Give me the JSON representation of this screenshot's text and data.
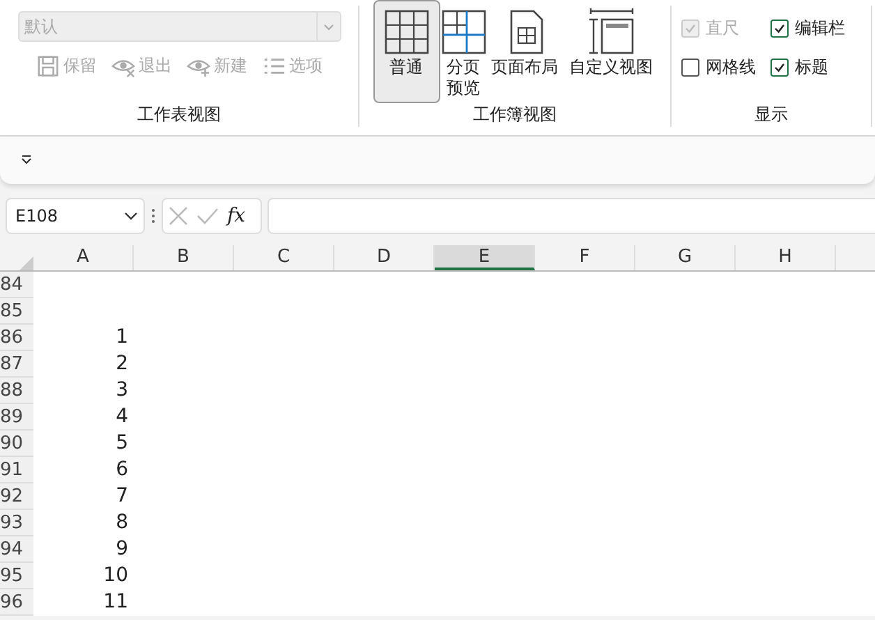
{
  "ribbon": {
    "sheet_view": {
      "dropdown": {
        "value": "默认",
        "disabled": true
      },
      "buttons": [
        {
          "label": "保留",
          "disabled": true
        },
        {
          "label": "退出",
          "disabled": true
        },
        {
          "label": "新建",
          "disabled": true
        },
        {
          "label": "选项",
          "disabled": true
        }
      ],
      "label": "工作表视图"
    },
    "workbook_view": {
      "buttons": [
        {
          "label": "普通",
          "selected": true
        },
        {
          "label": "分页预览",
          "selected": false
        },
        {
          "label": "页面布局",
          "selected": false
        },
        {
          "label": "自定义视图",
          "selected": false
        }
      ],
      "label": "工作簿视图"
    },
    "show": {
      "checkboxes": [
        {
          "label": "直尺",
          "checked": true,
          "disabled": true
        },
        {
          "label": "编辑栏",
          "checked": true,
          "disabled": false
        },
        {
          "label": "网格线",
          "checked": false,
          "disabled": false
        },
        {
          "label": "标题",
          "checked": true,
          "disabled": false
        }
      ],
      "label": "显示"
    }
  },
  "formula_bar": {
    "name_box": "E108",
    "fx": "fx"
  },
  "sheet": {
    "columns": [
      {
        "label": "A",
        "selected": false
      },
      {
        "label": "B",
        "selected": false
      },
      {
        "label": "C",
        "selected": false
      },
      {
        "label": "D",
        "selected": false
      },
      {
        "label": "E",
        "selected": true
      },
      {
        "label": "F",
        "selected": false
      },
      {
        "label": "G",
        "selected": false
      },
      {
        "label": "H",
        "selected": false
      }
    ],
    "rows": [
      {
        "header": "84"
      },
      {
        "header": "85"
      },
      {
        "header": "86",
        "value": "1"
      },
      {
        "header": "87",
        "value": "2"
      },
      {
        "header": "88",
        "value": "3"
      },
      {
        "header": "89",
        "value": "4"
      },
      {
        "header": "90",
        "value": "5"
      },
      {
        "header": "91",
        "value": "6"
      },
      {
        "header": "92",
        "value": "7"
      },
      {
        "header": "93",
        "value": "8"
      },
      {
        "header": "94",
        "value": "9"
      },
      {
        "header": "95",
        "value": "10"
      },
      {
        "header": "96",
        "value": "11"
      }
    ]
  }
}
